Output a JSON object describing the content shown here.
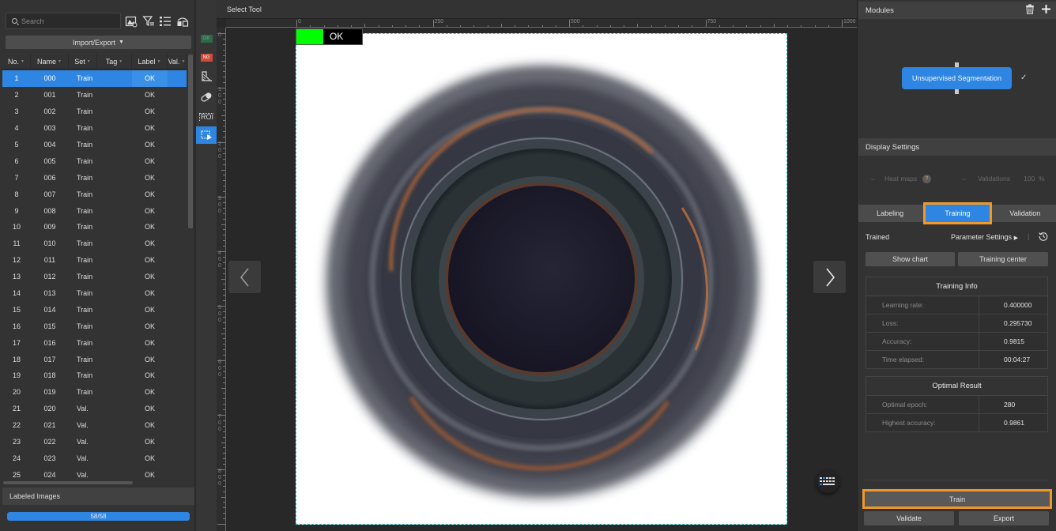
{
  "left_panel": {
    "search_placeholder": "Search",
    "toolbar_icons": [
      "image-settings-icon",
      "filter-icon",
      "list-icon",
      "layout-icon"
    ],
    "import_export_label": "Import/Export",
    "columns": [
      "No.",
      "Name",
      "Set",
      "Tag",
      "Label",
      "Val."
    ],
    "rows": [
      {
        "no": "1",
        "name": "000",
        "set": "Train",
        "tag": "",
        "label": "OK",
        "selected": true
      },
      {
        "no": "2",
        "name": "001",
        "set": "Train",
        "tag": "",
        "label": "OK"
      },
      {
        "no": "3",
        "name": "002",
        "set": "Train",
        "tag": "",
        "label": "OK"
      },
      {
        "no": "4",
        "name": "003",
        "set": "Train",
        "tag": "",
        "label": "OK"
      },
      {
        "no": "5",
        "name": "004",
        "set": "Train",
        "tag": "",
        "label": "OK"
      },
      {
        "no": "6",
        "name": "005",
        "set": "Train",
        "tag": "",
        "label": "OK"
      },
      {
        "no": "7",
        "name": "006",
        "set": "Train",
        "tag": "",
        "label": "OK"
      },
      {
        "no": "8",
        "name": "007",
        "set": "Train",
        "tag": "",
        "label": "OK"
      },
      {
        "no": "9",
        "name": "008",
        "set": "Train",
        "tag": "",
        "label": "OK"
      },
      {
        "no": "10",
        "name": "009",
        "set": "Train",
        "tag": "",
        "label": "OK"
      },
      {
        "no": "11",
        "name": "010",
        "set": "Train",
        "tag": "",
        "label": "OK"
      },
      {
        "no": "12",
        "name": "011",
        "set": "Train",
        "tag": "",
        "label": "OK"
      },
      {
        "no": "13",
        "name": "012",
        "set": "Train",
        "tag": "",
        "label": "OK"
      },
      {
        "no": "14",
        "name": "013",
        "set": "Train",
        "tag": "",
        "label": "OK"
      },
      {
        "no": "15",
        "name": "014",
        "set": "Train",
        "tag": "",
        "label": "OK"
      },
      {
        "no": "16",
        "name": "015",
        "set": "Train",
        "tag": "",
        "label": "OK"
      },
      {
        "no": "17",
        "name": "016",
        "set": "Train",
        "tag": "",
        "label": "OK"
      },
      {
        "no": "18",
        "name": "017",
        "set": "Train",
        "tag": "",
        "label": "OK"
      },
      {
        "no": "19",
        "name": "018",
        "set": "Train",
        "tag": "",
        "label": "OK"
      },
      {
        "no": "20",
        "name": "019",
        "set": "Train",
        "tag": "",
        "label": "OK"
      },
      {
        "no": "21",
        "name": "020",
        "set": "Val.",
        "tag": "",
        "label": "OK"
      },
      {
        "no": "22",
        "name": "021",
        "set": "Val.",
        "tag": "",
        "label": "OK"
      },
      {
        "no": "23",
        "name": "022",
        "set": "Val.",
        "tag": "",
        "label": "OK"
      },
      {
        "no": "24",
        "name": "023",
        "set": "Val.",
        "tag": "",
        "label": "OK"
      },
      {
        "no": "25",
        "name": "024",
        "set": "Val.",
        "tag": "",
        "label": "OK"
      }
    ],
    "labeled_images_label": "Labeled Images",
    "labeled_progress_text": "58/58",
    "labeled_progress_fraction": 1.0
  },
  "tool_strip": {
    "ok_badge": "OK",
    "ng_badge": "NG",
    "roi_label": "ROI",
    "active_tool": "select-tool"
  },
  "canvas": {
    "title": "Select Tool",
    "h_ruler_labels": [
      "0",
      "250",
      "500",
      "750",
      "1000"
    ],
    "v_ruler_labels": [
      "0",
      "100",
      "200",
      "300",
      "400",
      "500",
      "600",
      "700",
      "800"
    ],
    "image_label": "OK",
    "image_label_color": "#00ff00"
  },
  "right_panel": {
    "modules_title": "Modules",
    "module_name": "Unsupervised Segmentation",
    "display_settings_title": "Display Settings",
    "heat_maps_label": "Heat maps",
    "validations_label": "Validations",
    "validations_value": "100",
    "validations_unit": "%",
    "tabs": [
      "Labeling",
      "Training",
      "Validation"
    ],
    "active_tab": "Training",
    "status": "Trained",
    "parameter_settings_label": "Parameter Settings",
    "show_chart_label": "Show chart",
    "training_center_label": "Training center",
    "training_info": {
      "title": "Training Info",
      "rows": [
        {
          "key": "Learning rate:",
          "value": "0.400000"
        },
        {
          "key": "Loss:",
          "value": "0.295730"
        },
        {
          "key": "Accuracy:",
          "value": "0.9815"
        },
        {
          "key": "Time elapsed:",
          "value": "00:04:27"
        }
      ]
    },
    "optimal_result": {
      "title": "Optimal Result",
      "rows": [
        {
          "key": "Optimal epoch:",
          "value": "280"
        },
        {
          "key": "Highest accuracy:",
          "value": "0.9861"
        }
      ]
    },
    "train_label": "Train",
    "validate_label": "Validate",
    "export_label": "Export"
  },
  "colors": {
    "accent": "#2e86e2",
    "highlight": "#f0982a",
    "ok_green": "#00ff00",
    "ng_red": "#d04a36"
  }
}
